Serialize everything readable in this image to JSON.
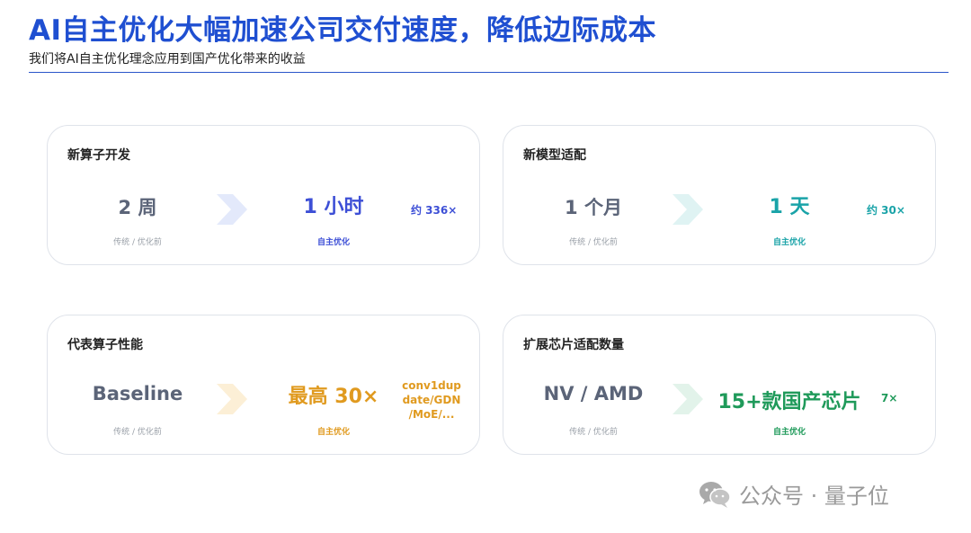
{
  "header": {
    "title": "AI自主优化大幅加速公司交付速度，降低边际成本",
    "subtitle": "我们将AI自主优化理念应用到国产优化带来的收益"
  },
  "cards": [
    {
      "title": "新算子开发",
      "before_value": "2 周",
      "before_label": "传统 / 优化前",
      "after_value": "1 小时",
      "after_label": "自主优化",
      "ratio": "约 336×",
      "accent": "#3d4fd6"
    },
    {
      "title": "新模型适配",
      "before_value": "1 个月",
      "before_label": "传统 / 优化前",
      "after_value": "1 天",
      "after_label": "自主优化",
      "ratio": "约 30×",
      "accent": "#1aa3a8"
    },
    {
      "title": "代表算子性能",
      "before_value": "Baseline",
      "before_label": "传统 / 优化前",
      "after_value": "最高 30×",
      "after_label": "自主优化",
      "ratio_lines": [
        "conv1dup",
        "date/GDN",
        "/MoE/..."
      ],
      "accent": "#e09a1f"
    },
    {
      "title": "扩展芯片适配数量",
      "before_value": "NV / AMD",
      "before_label": "传统 / 优化前",
      "after_value": "15+款国产芯片",
      "after_label": "自主优化",
      "ratio": "7×",
      "accent": "#1f9a5a"
    }
  ],
  "watermark": {
    "icon": "wechat-icon",
    "text": "公众号 · 量子位"
  }
}
